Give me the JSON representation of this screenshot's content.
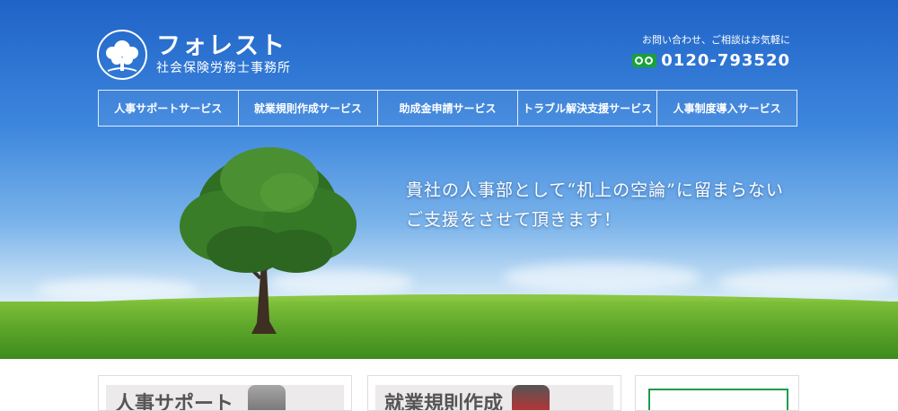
{
  "header": {
    "logo_name": "フォレスト",
    "logo_sub": "社会保険労務士事務所",
    "contact_label": "お問い合わせ、ご相談はお気軽に",
    "phone": "0120-793520"
  },
  "nav": {
    "items": [
      {
        "label": "人事サポートサービス"
      },
      {
        "label": "就業規則作成サービス"
      },
      {
        "label": "助成金申請サービス"
      },
      {
        "label": "トラブル解決支援サービス"
      },
      {
        "label": "人事制度導入サービス"
      }
    ]
  },
  "hero": {
    "tagline_line1": "貴社の人事部として“机上の空論”に留まらない",
    "tagline_line2": "ご支援をさせて頂きます！"
  },
  "cards": [
    {
      "title": "人事サポート"
    },
    {
      "title": "就業規則作成"
    }
  ],
  "colors": {
    "sky_top": "#1f63c7",
    "grass": "#5da62a",
    "freedial_green": "#19a23a"
  },
  "icons": {
    "logo": "tree-logo-icon",
    "freedial": "freedial-icon"
  }
}
